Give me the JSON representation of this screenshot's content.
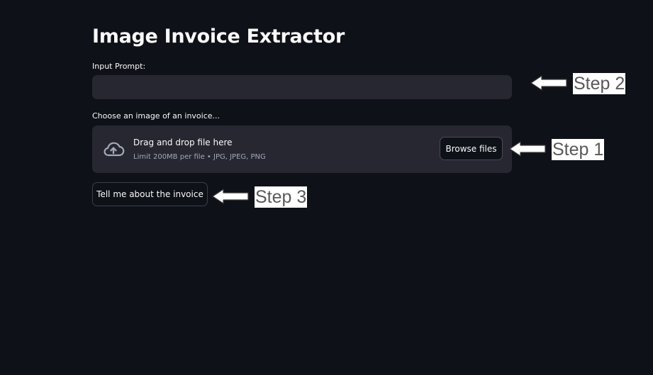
{
  "app": {
    "title": "Image Invoice Extractor"
  },
  "prompt": {
    "label": "Input Prompt:",
    "value": "",
    "placeholder": ""
  },
  "uploader": {
    "label": "Choose an image of an invoice...",
    "drag_text": "Drag and drop file here",
    "limit_text": "Limit 200MB per file • JPG, JPEG, PNG",
    "browse_label": "Browse files",
    "icon": "cloud-upload-icon"
  },
  "submit": {
    "label": "Tell me about the invoice"
  },
  "annotations": [
    {
      "arrow_icon": "left-arrow-icon",
      "label": "Step 2"
    },
    {
      "arrow_icon": "left-arrow-icon",
      "label": "Step 1"
    },
    {
      "arrow_icon": "left-arrow-icon",
      "label": "Step 3"
    }
  ],
  "colors": {
    "background": "#0e1117",
    "widget_bg": "#262730",
    "text": "#fafafa",
    "muted_text": "#a3a8b8",
    "annotation_text": "#595959",
    "annotation_bg": "#ffffff"
  }
}
